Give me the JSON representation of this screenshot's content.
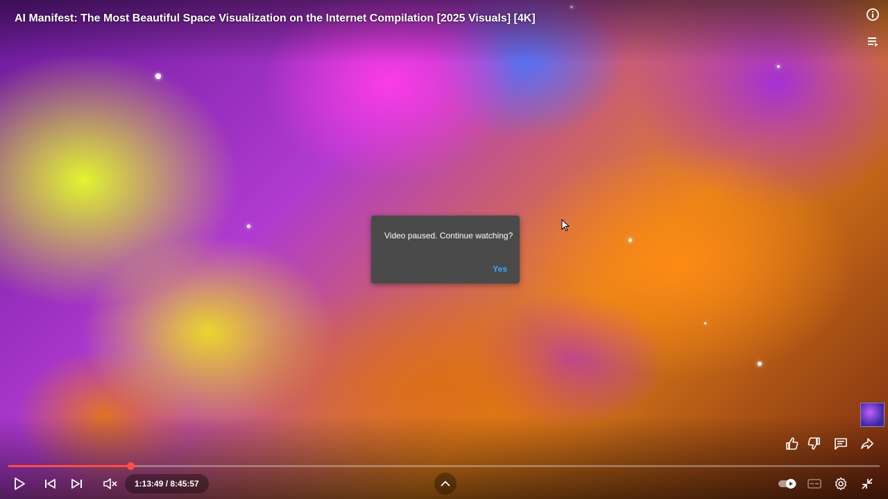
{
  "video": {
    "title": "AI Manifest: The Most Beautiful Space Visualization on the Internet Compilation [2025 Visuals] [4K]"
  },
  "dialog": {
    "message": "Video paused. Continue watching?",
    "confirm_label": "Yes"
  },
  "player": {
    "time_display": "1:13:49 / 8:45:57",
    "current_time": "1:13:49",
    "duration": "8:45:57",
    "progress_fraction": 0.14,
    "progress_color": "#ff4e45",
    "muted": true,
    "autoplay_on": true
  },
  "icons": {
    "info": "info-icon",
    "queue": "queue-icon",
    "play": "play-icon",
    "previous": "previous-icon",
    "next": "next-icon",
    "mute": "muted-volume-icon",
    "expand": "chevron-up-icon",
    "autoplay": "autoplay-toggle-icon",
    "captions": "captions-icon",
    "settings": "settings-gear-icon",
    "exit_fullscreen": "exit-fullscreen-icon",
    "like": "thumbs-up-icon",
    "dislike": "thumbs-down-icon",
    "comments": "comment-icon",
    "share": "share-icon"
  },
  "colors": {
    "dialog_bg": "#4a4a4a",
    "dialog_accent": "#3ea6ff"
  }
}
